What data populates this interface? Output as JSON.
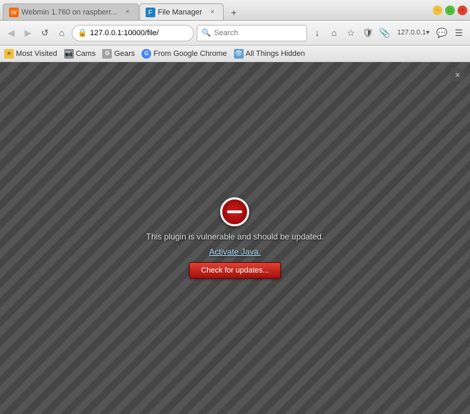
{
  "window": {
    "titlebar": {
      "tabs": [
        {
          "id": "tab-webmin",
          "label": "Webmin 1.760 on raspberr...",
          "active": false,
          "favicon": "W"
        },
        {
          "id": "tab-filemanager",
          "label": "File Manager",
          "active": true,
          "favicon": "F"
        }
      ],
      "new_tab_label": "+",
      "controls": {
        "minimize": "−",
        "maximize": "□",
        "close": "×"
      }
    },
    "navbar": {
      "back_label": "◀",
      "forward_label": "▶",
      "reload_label": "↺",
      "home_label": "⌂",
      "url": "127.0.0.1:10000/file/",
      "search_placeholder": "Search",
      "download_label": "↓",
      "bookmark_label": "☆",
      "shield_label": "🛡",
      "clip_label": "📎",
      "account_label": "127.0.0.1▾",
      "chat_label": "💬",
      "menu_label": "☰"
    },
    "bookmarks": [
      {
        "id": "most-visited",
        "label": "Most Visited",
        "icon": "★",
        "icon_class": "star"
      },
      {
        "id": "cams",
        "label": "Cams",
        "icon": "📷",
        "icon_class": "cam"
      },
      {
        "id": "gears",
        "label": "Gears",
        "icon": "⚙",
        "icon_class": "gear"
      },
      {
        "id": "from-google-chrome",
        "label": "From Google Chrome",
        "icon": "G",
        "icon_class": "chrome"
      },
      {
        "id": "all-things-hidden",
        "label": "All Things Hidden",
        "icon": "👁",
        "icon_class": "eye"
      }
    ],
    "plugin": {
      "icon_aria": "blocked-plugin-icon",
      "message": "This plugin is vulnerable and should be updated.",
      "activate_link": "Activate Java.",
      "button_label": "Check for updates..."
    }
  }
}
